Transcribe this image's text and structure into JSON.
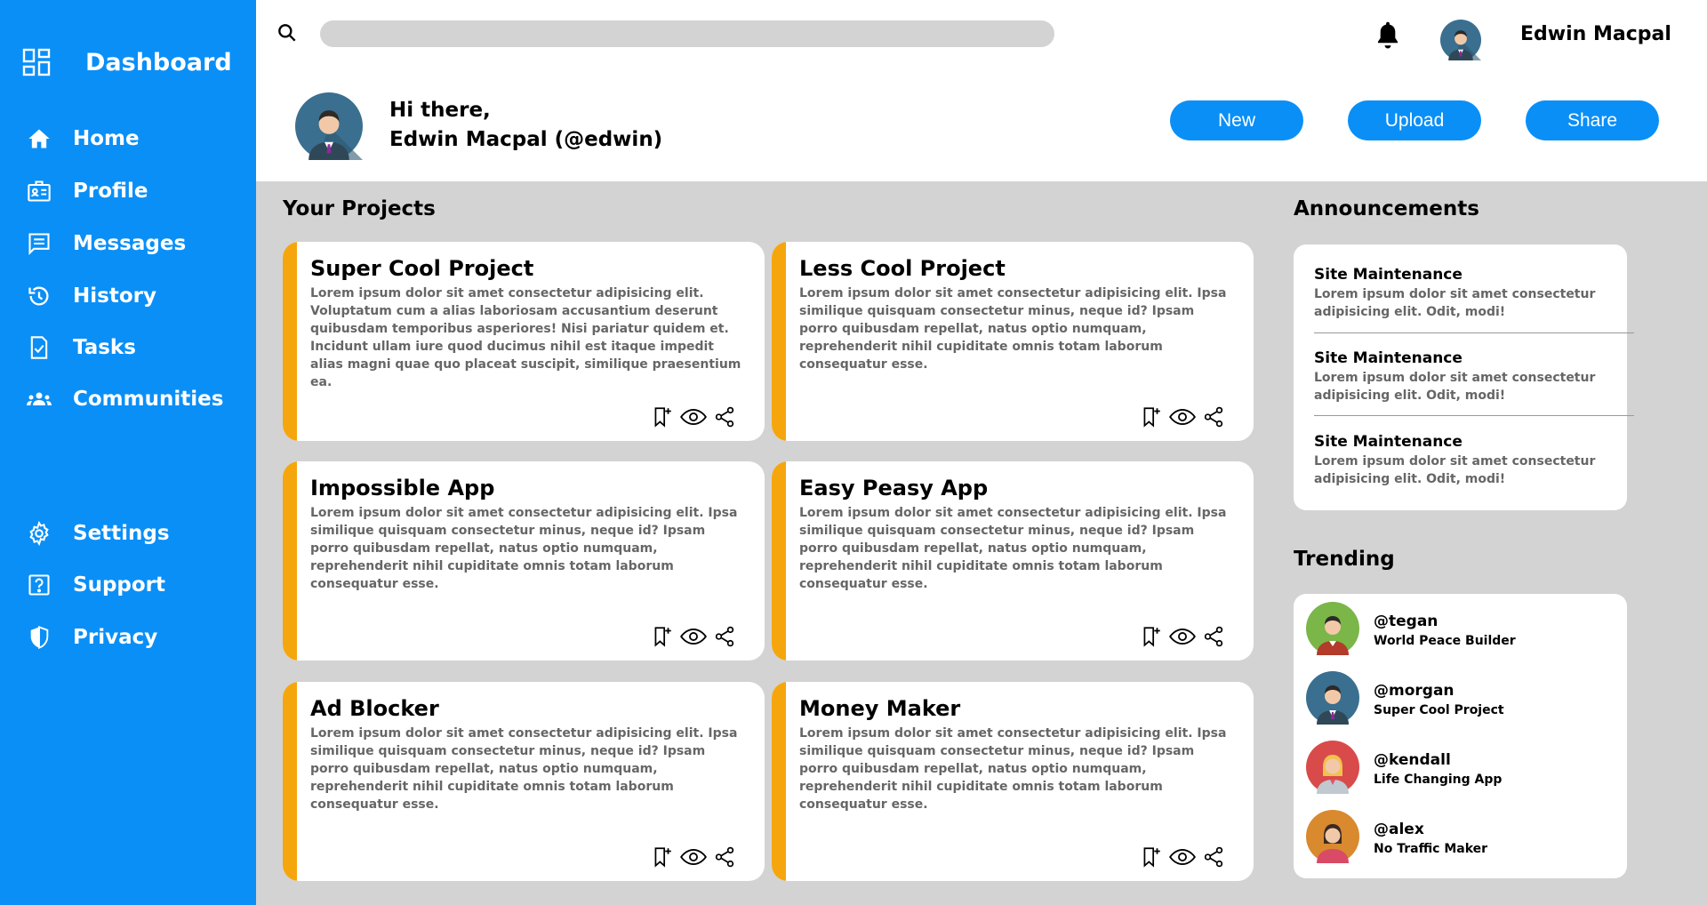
{
  "sidebar": {
    "brand": "Dashboard",
    "items": [
      {
        "label": "Home",
        "icon": "home-icon"
      },
      {
        "label": "Profile",
        "icon": "id-card-icon"
      },
      {
        "label": "Messages",
        "icon": "message-icon"
      },
      {
        "label": "History",
        "icon": "history-icon"
      },
      {
        "label": "Tasks",
        "icon": "task-icon"
      },
      {
        "label": "Communities",
        "icon": "people-icon"
      },
      {
        "label": "Settings",
        "icon": "gear-icon"
      },
      {
        "label": "Support",
        "icon": "help-icon"
      },
      {
        "label": "Privacy",
        "icon": "shield-icon"
      }
    ]
  },
  "header": {
    "search_placeholder": "",
    "user_name": "Edwin Macpal",
    "greeting_line1": "Hi there,",
    "greeting_line2": "Edwin Macpal (@edwin)",
    "buttons": {
      "new": "New",
      "upload": "Upload",
      "share": "Share"
    }
  },
  "projects": {
    "title": "Your Projects",
    "items": [
      {
        "title": "Super Cool Project",
        "desc": "Lorem ipsum dolor sit amet consectetur adipisicing elit. Voluptatum cum a alias laboriosam accusantium deserunt quibusdam temporibus asperiores! Nisi pariatur quidem et. Incidunt ullam iure quod ducimus nihil est itaque impedit alias magni quae quo placeat suscipit, similique praesentium ea."
      },
      {
        "title": "Less Cool Project",
        "desc": "Lorem ipsum dolor sit amet consectetur adipisicing elit. Ipsa similique quisquam consectetur minus, neque id? Ipsam porro quibusdam repellat, natus optio numquam, reprehenderit nihil cupiditate omnis totam laborum consequatur esse."
      },
      {
        "title": "Impossible App",
        "desc": "Lorem ipsum dolor sit amet consectetur adipisicing elit. Ipsa similique quisquam consectetur minus, neque id? Ipsam porro quibusdam repellat, natus optio numquam, reprehenderit nihil cupiditate omnis totam laborum consequatur esse."
      },
      {
        "title": "Easy Peasy App",
        "desc": "Lorem ipsum dolor sit amet consectetur adipisicing elit. Ipsa similique quisquam consectetur minus, neque id? Ipsam porro quibusdam repellat, natus optio numquam, reprehenderit nihil cupiditate omnis totam laborum consequatur esse."
      },
      {
        "title": "Ad Blocker",
        "desc": "Lorem ipsum dolor sit amet consectetur adipisicing elit. Ipsa similique quisquam consectetur minus, neque id? Ipsam porro quibusdam repellat, natus optio numquam, reprehenderit nihil cupiditate omnis totam laborum consequatur esse."
      },
      {
        "title": "Money Maker",
        "desc": "Lorem ipsum dolor sit amet consectetur adipisicing elit. Ipsa similique quisquam consectetur minus, neque id? Ipsam porro quibusdam repellat, natus optio numquam, reprehenderit nihil cupiditate omnis totam laborum consequatur esse."
      }
    ]
  },
  "announcements": {
    "title": "Announcements",
    "items": [
      {
        "title": "Site Maintenance",
        "desc": "Lorem ipsum dolor sit amet consectetur adipisicing elit. Odit, modi!"
      },
      {
        "title": "Site Maintenance",
        "desc": "Lorem ipsum dolor sit amet consectetur adipisicing elit. Odit, modi!"
      },
      {
        "title": "Site Maintenance",
        "desc": "Lorem ipsum dolor sit amet consectetur adipisicing elit. Odit, modi!"
      }
    ]
  },
  "trending": {
    "title": "Trending",
    "items": [
      {
        "handle": "@tegan",
        "project": "World Peace Builder"
      },
      {
        "handle": "@morgan",
        "project": "Super Cool Project"
      },
      {
        "handle": "@kendall",
        "project": "Life Changing App"
      },
      {
        "handle": "@alex",
        "project": "No Traffic Maker"
      }
    ]
  },
  "colors": {
    "sidebar_bg": "#0a8ff7",
    "accent": "#f6a60d",
    "page_bg": "#d3d3d3"
  }
}
